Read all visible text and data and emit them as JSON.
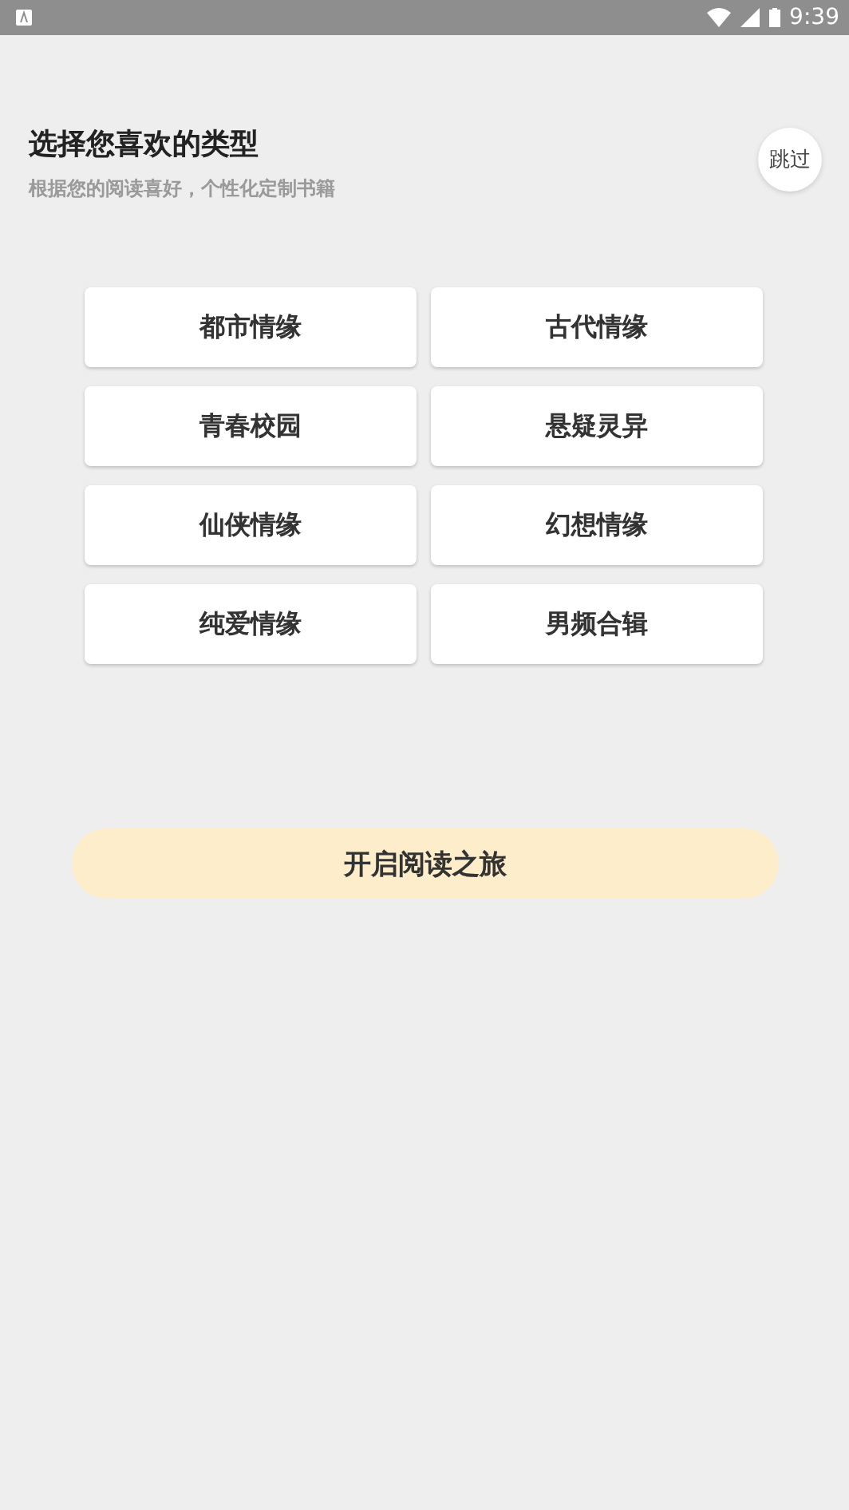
{
  "status_bar": {
    "time": "9:39"
  },
  "header": {
    "title": "选择您喜欢的类型",
    "subtitle": "根据您的阅读喜好，个性化定制书籍",
    "skip": "跳过"
  },
  "genres": [
    {
      "label": "都市情缘",
      "selected": false
    },
    {
      "label": "古代情缘",
      "selected": false
    },
    {
      "label": "青春校园",
      "selected": false
    },
    {
      "label": "悬疑灵异",
      "selected": false
    },
    {
      "label": "仙侠情缘",
      "selected": false
    },
    {
      "label": "幻想情缘",
      "selected": false
    },
    {
      "label": "纯爱情缘",
      "selected": false
    },
    {
      "label": "男频合辑",
      "selected": false
    }
  ],
  "start_button": "开启阅读之旅"
}
